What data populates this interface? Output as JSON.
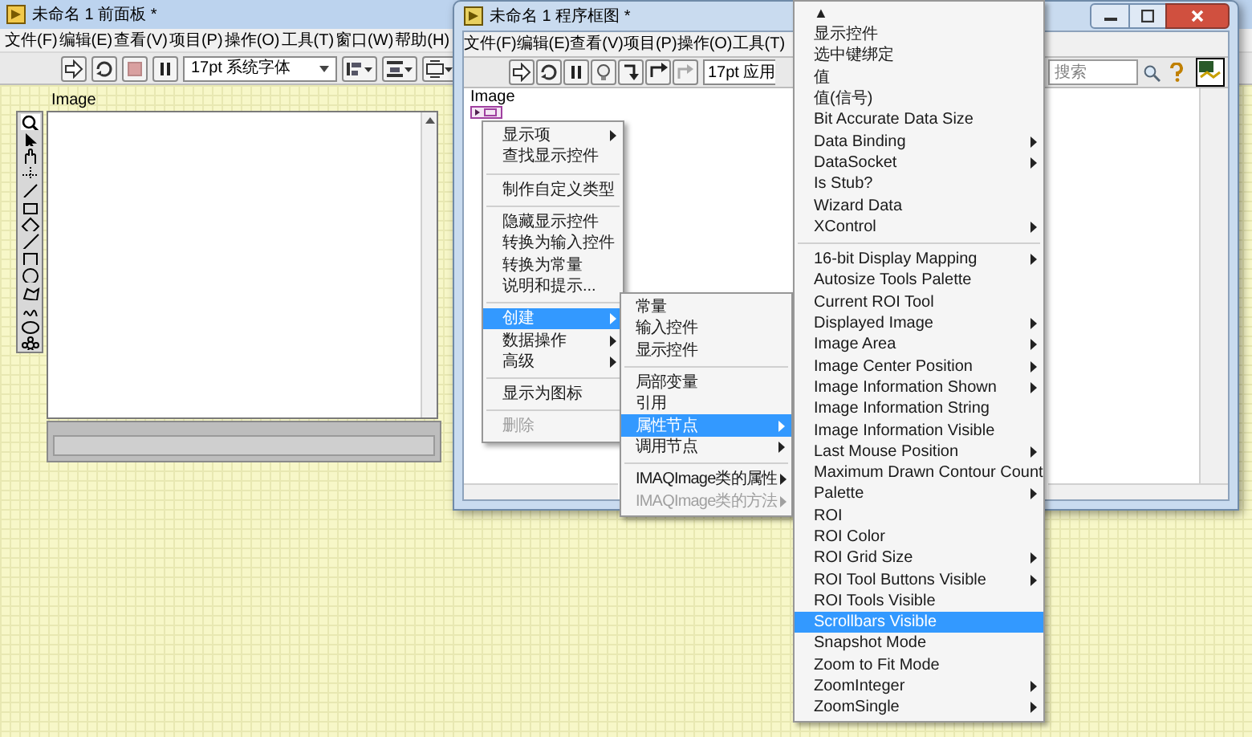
{
  "front_panel": {
    "title": "未命名 1 前面板 *",
    "menu": [
      "文件(F)",
      "编辑(E)",
      "查看(V)",
      "项目(P)",
      "操作(O)",
      "工具(T)",
      "窗口(W)",
      "帮助(H)"
    ],
    "font_selector": "17pt 系统字体",
    "image_control": {
      "label": "Image"
    }
  },
  "block_diagram": {
    "title": "未命名 1 程序框图 *",
    "menu": [
      "文件(F)",
      "编辑(E)",
      "查看(V)",
      "项目(P)",
      "操作(O)",
      "工具(T)"
    ],
    "font_selector": "17pt 应用",
    "search": {
      "placeholder": "搜索"
    },
    "terminal": {
      "label": "Image"
    }
  },
  "shortcut_menu": [
    {
      "kind": "item",
      "label": "显示项",
      "submenu": true,
      "selected": false,
      "disabled": false
    },
    {
      "kind": "item",
      "label": "查找显示控件",
      "submenu": false,
      "selected": false,
      "disabled": false
    },
    {
      "kind": "separator"
    },
    {
      "kind": "item",
      "label": "制作自定义类型",
      "submenu": false,
      "selected": false,
      "disabled": false
    },
    {
      "kind": "separator"
    },
    {
      "kind": "item",
      "label": "隐藏显示控件",
      "submenu": false,
      "selected": false,
      "disabled": false
    },
    {
      "kind": "item",
      "label": "转换为输入控件",
      "submenu": false,
      "selected": false,
      "disabled": false
    },
    {
      "kind": "item",
      "label": "转换为常量",
      "submenu": false,
      "selected": false,
      "disabled": false
    },
    {
      "kind": "item",
      "label": "说明和提示...",
      "submenu": false,
      "selected": false,
      "disabled": false
    },
    {
      "kind": "separator"
    },
    {
      "kind": "item",
      "label": "创建",
      "submenu": true,
      "selected": true,
      "disabled": false
    },
    {
      "kind": "item",
      "label": "数据操作",
      "submenu": true,
      "selected": false,
      "disabled": false
    },
    {
      "kind": "item",
      "label": "高级",
      "submenu": true,
      "selected": false,
      "disabled": false
    },
    {
      "kind": "separator"
    },
    {
      "kind": "item",
      "label": "显示为图标",
      "submenu": false,
      "selected": false,
      "disabled": false
    },
    {
      "kind": "separator"
    },
    {
      "kind": "item",
      "label": "删除",
      "submenu": false,
      "selected": false,
      "disabled": true
    }
  ],
  "create_submenu": [
    {
      "kind": "item",
      "label": "常量",
      "submenu": false,
      "selected": false,
      "disabled": false
    },
    {
      "kind": "item",
      "label": "输入控件",
      "submenu": false,
      "selected": false,
      "disabled": false
    },
    {
      "kind": "item",
      "label": "显示控件",
      "submenu": false,
      "selected": false,
      "disabled": false
    },
    {
      "kind": "separator"
    },
    {
      "kind": "item",
      "label": "局部变量",
      "submenu": false,
      "selected": false,
      "disabled": false
    },
    {
      "kind": "item",
      "label": "引用",
      "submenu": false,
      "selected": false,
      "disabled": false
    },
    {
      "kind": "item",
      "label": "属性节点",
      "submenu": true,
      "selected": true,
      "disabled": false
    },
    {
      "kind": "item",
      "label": "调用节点",
      "submenu": true,
      "selected": false,
      "disabled": false
    },
    {
      "kind": "separator"
    },
    {
      "kind": "item",
      "label": "IMAQImage类的属性",
      "submenu": true,
      "selected": false,
      "disabled": false
    },
    {
      "kind": "item",
      "label": "IMAQImage类的方法",
      "submenu": true,
      "selected": false,
      "disabled": true
    }
  ],
  "property_menu": [
    {
      "kind": "scroll_up",
      "label": "▲"
    },
    {
      "kind": "item",
      "label": "显示控件",
      "submenu": false,
      "selected": false,
      "disabled": false
    },
    {
      "kind": "item",
      "label": "选中键绑定",
      "submenu": false,
      "selected": false,
      "disabled": false
    },
    {
      "kind": "item",
      "label": "值",
      "submenu": false,
      "selected": false,
      "disabled": false
    },
    {
      "kind": "item",
      "label": "值(信号)",
      "submenu": false,
      "selected": false,
      "disabled": false
    },
    {
      "kind": "item",
      "label": "Bit Accurate Data Size",
      "submenu": false,
      "selected": false,
      "disabled": false
    },
    {
      "kind": "item",
      "label": "Data Binding",
      "submenu": true,
      "selected": false,
      "disabled": false
    },
    {
      "kind": "item",
      "label": "DataSocket",
      "submenu": true,
      "selected": false,
      "disabled": false
    },
    {
      "kind": "item",
      "label": "Is Stub?",
      "submenu": false,
      "selected": false,
      "disabled": false
    },
    {
      "kind": "item",
      "label": "Wizard Data",
      "submenu": false,
      "selected": false,
      "disabled": false
    },
    {
      "kind": "item",
      "label": "XControl",
      "submenu": true,
      "selected": false,
      "disabled": false
    },
    {
      "kind": "separator"
    },
    {
      "kind": "item",
      "label": "16-bit Display Mapping",
      "submenu": true,
      "selected": false,
      "disabled": false
    },
    {
      "kind": "item",
      "label": "Autosize Tools Palette",
      "submenu": false,
      "selected": false,
      "disabled": false
    },
    {
      "kind": "item",
      "label": "Current ROI Tool",
      "submenu": false,
      "selected": false,
      "disabled": false
    },
    {
      "kind": "item",
      "label": "Displayed Image",
      "submenu": true,
      "selected": false,
      "disabled": false
    },
    {
      "kind": "item",
      "label": "Image Area",
      "submenu": true,
      "selected": false,
      "disabled": false
    },
    {
      "kind": "item",
      "label": "Image Center Position",
      "submenu": true,
      "selected": false,
      "disabled": false
    },
    {
      "kind": "item",
      "label": "Image Information Shown",
      "submenu": true,
      "selected": false,
      "disabled": false
    },
    {
      "kind": "item",
      "label": "Image Information String",
      "submenu": false,
      "selected": false,
      "disabled": false
    },
    {
      "kind": "item",
      "label": "Image Information Visible",
      "submenu": false,
      "selected": false,
      "disabled": false
    },
    {
      "kind": "item",
      "label": "Last Mouse Position",
      "submenu": true,
      "selected": false,
      "disabled": false
    },
    {
      "kind": "item",
      "label": "Maximum Drawn Contour Count",
      "submenu": false,
      "selected": false,
      "disabled": false
    },
    {
      "kind": "item",
      "label": "Palette",
      "submenu": true,
      "selected": false,
      "disabled": false
    },
    {
      "kind": "item",
      "label": "ROI",
      "submenu": false,
      "selected": false,
      "disabled": false
    },
    {
      "kind": "item",
      "label": "ROI Color",
      "submenu": false,
      "selected": false,
      "disabled": false
    },
    {
      "kind": "item",
      "label": "ROI Grid Size",
      "submenu": true,
      "selected": false,
      "disabled": false
    },
    {
      "kind": "item",
      "label": "ROI Tool Buttons Visible",
      "submenu": true,
      "selected": false,
      "disabled": false
    },
    {
      "kind": "item",
      "label": "ROI Tools Visible",
      "submenu": false,
      "selected": false,
      "disabled": false
    },
    {
      "kind": "item",
      "label": "Scrollbars Visible",
      "submenu": false,
      "selected": true,
      "disabled": false
    },
    {
      "kind": "item",
      "label": "Snapshot Mode",
      "submenu": false,
      "selected": false,
      "disabled": false
    },
    {
      "kind": "item",
      "label": "Zoom to Fit Mode",
      "submenu": false,
      "selected": false,
      "disabled": false
    },
    {
      "kind": "item",
      "label": "ZoomInteger",
      "submenu": true,
      "selected": false,
      "disabled": false
    },
    {
      "kind": "item",
      "label": "ZoomSingle",
      "submenu": true,
      "selected": false,
      "disabled": false
    }
  ]
}
